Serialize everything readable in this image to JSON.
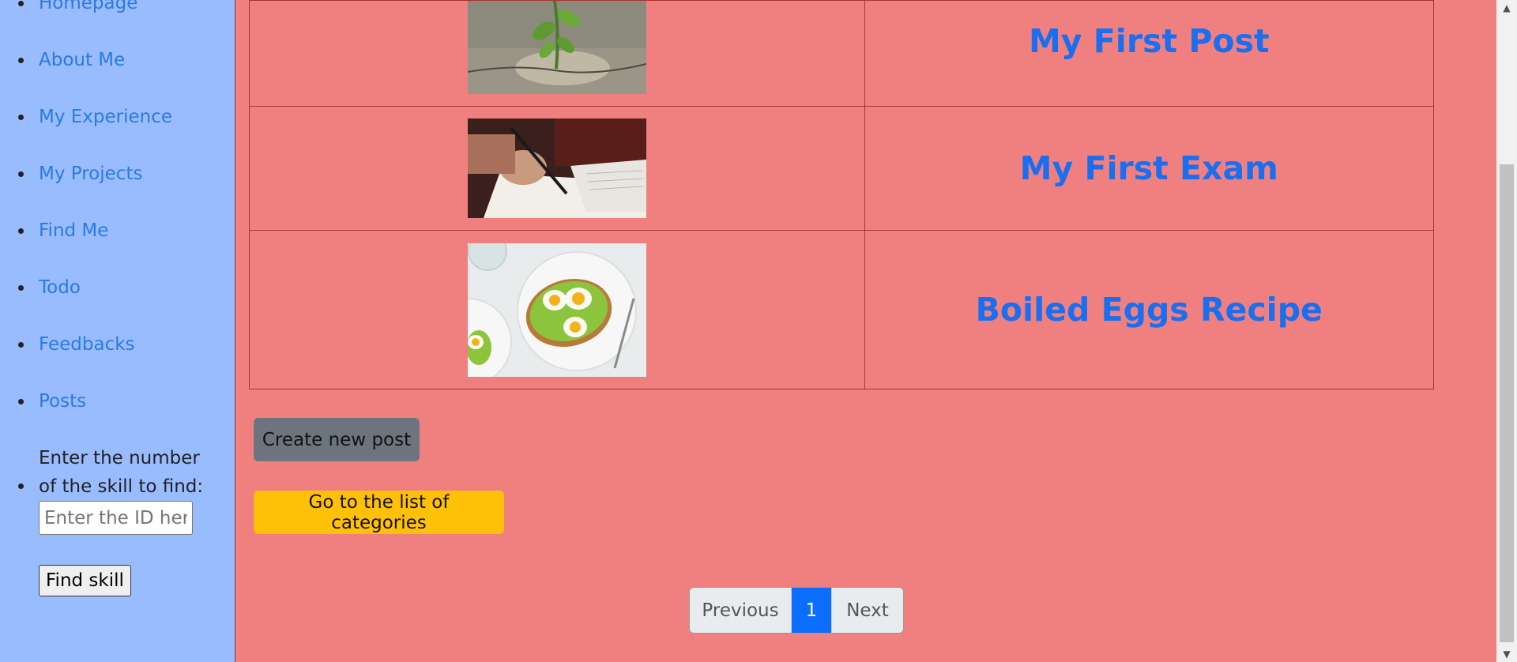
{
  "sidebar": {
    "items": [
      {
        "label": "Homepage"
      },
      {
        "label": "About Me"
      },
      {
        "label": "My Experience"
      },
      {
        "label": "My Projects"
      },
      {
        "label": "Find Me"
      },
      {
        "label": "Todo"
      },
      {
        "label": "Feedbacks"
      },
      {
        "label": "Posts"
      }
    ],
    "skill_search": {
      "label": "Enter the number of the skill to find:",
      "placeholder": "Enter the ID here",
      "value": "",
      "button_label": "Find skill"
    }
  },
  "posts": [
    {
      "title": "My First Post",
      "image": "plant-sprout-image"
    },
    {
      "title": "My First Exam",
      "image": "writing-exam-image"
    },
    {
      "title": "Boiled Eggs Recipe",
      "image": "egg-avocado-toast-image"
    }
  ],
  "actions": {
    "create_label": "Create new post",
    "categories_label": "Go to the list of categories"
  },
  "pagination": {
    "previous_label": "Previous",
    "current_page": "1",
    "next_label": "Next"
  },
  "colors": {
    "sidebar_bg": "#99bcff",
    "main_bg": "#f08080",
    "link": "#2a7ae2",
    "title": "#1a6ef0",
    "create_button": "#6c757d",
    "categories_button": "#ffc107",
    "active_page": "#0d6efd"
  }
}
